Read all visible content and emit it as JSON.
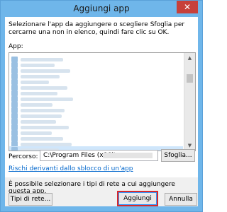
{
  "window": {
    "title": "Aggiungi app",
    "close_glyph": "✕"
  },
  "instructions": "Selezionare l'app da aggiungere o scegliere Sfoglia per cercarne una non in elenco, quindi fare clic su OK.",
  "app_list": {
    "label": "App:",
    "rows": 17,
    "selected_row": 16
  },
  "path": {
    "label": "Percorso:",
    "value": "C:\\Program Files (x86)\\",
    "browse_label": "Sfoglia..."
  },
  "risk_link": "Rischi derivanti dallo sblocco di un'app",
  "network_note": "È possibile selezionare i tipi di rete a cui aggiungere questa app.",
  "buttons": {
    "network_types": "Tipi di rete...",
    "add": "Aggiungi",
    "cancel": "Annulla"
  },
  "colors": {
    "title_bar": "#6fb6ea",
    "close_button": "#c7403a",
    "link": "#0066cc",
    "highlight": "#d8282a"
  },
  "icons": {
    "close": "close-icon",
    "scroll_up": "scroll-up-arrow-icon",
    "scroll_down": "scroll-down-arrow-icon"
  }
}
